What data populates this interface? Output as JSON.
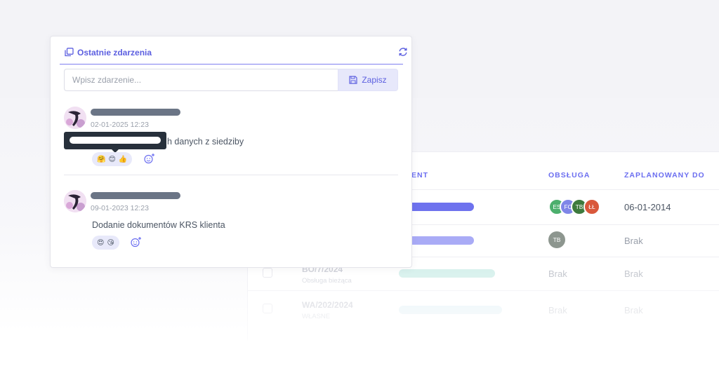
{
  "panel": {
    "title": "Ostatnie zdarzenia",
    "input_placeholder": "Wpisz zdarzenie...",
    "save_label": "Zapisz",
    "icons": {
      "title": "copy-icon",
      "refresh": "refresh-icon",
      "save": "floppy-disk-icon",
      "add_reaction": "add-emoji-icon"
    },
    "accent": "#5c5fe0"
  },
  "events": [
    {
      "timestamp": "02-01-2025 12:23",
      "message_visible": "h danych z siedziby",
      "reactions": [
        "🤗",
        "😊",
        "👍"
      ]
    },
    {
      "timestamp": "09-01-2023 12:23",
      "message_visible": "Dodanie dokumentów KRS klienta",
      "reactions": [
        "😍",
        "😘"
      ]
    }
  ],
  "table": {
    "headers": {
      "client_partial": "ENT",
      "service": "OBSŁUGA",
      "planned": "ZAPLANOWANY DO"
    },
    "rows": [
      {
        "code": "",
        "subtitle": "",
        "service_avatars": [
          "ES",
          "FC",
          "TB",
          "ŁŁ"
        ],
        "planned": "06-01-2014",
        "bar_color": "#6e72ee"
      },
      {
        "code": "",
        "subtitle": "",
        "service_avatars": [
          "TB"
        ],
        "planned": "Brak",
        "bar_color": "#a9abf6"
      },
      {
        "code": "BO/7/2024",
        "subtitle": "Obsługa bieżąca",
        "service_text": "Brak",
        "planned": "Brak",
        "bar_color": "#cfeee9"
      },
      {
        "code": "WA/202/2024",
        "subtitle": "WŁASNE",
        "service_text": "Brak",
        "planned": "Brak",
        "bar_color": "#e3f1f6"
      }
    ],
    "avatar_colors": {
      "ES": "#4caf6d",
      "FC": "#7f86e8",
      "TB": "#3d7a3d",
      "ŁŁ": "#d9583b",
      "TB2": "#8d968f"
    }
  }
}
